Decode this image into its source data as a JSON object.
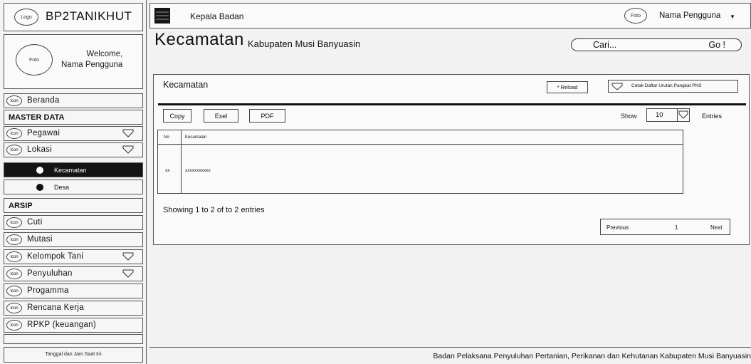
{
  "sidebar": {
    "logo_label": "Logo",
    "brand": "BP2TANIKHUT",
    "photo_label": "Foto",
    "welcome_line1": "Welcome,",
    "welcome_line2": "Nama Pengguna",
    "icon_label": "Icon",
    "home": "Beranda",
    "master_header": "MASTER DATA",
    "pegawai": "Pegawai",
    "lokasi": "Lokasi",
    "kecamatan": "Kecamatan",
    "desa": "Desa",
    "arsip_header": "ARSIP",
    "cuti": "Cuti",
    "mutasi": "Mutasi",
    "kelompok_tani": "Kelompok Tani",
    "penyuluhan": "Penyuluhan",
    "progamma": "Progamma",
    "rencana_kerja": "Rencana Kerja",
    "rpkp": "RPKP (keuangan)",
    "footer": "Tanggal dan Jam Saat Ini"
  },
  "header": {
    "role_title": "Kepala Badan",
    "photo_label": "Foto",
    "user_name": "Nama Pengguna",
    "caret": "▼"
  },
  "page": {
    "title": "Kecamatan",
    "subtitle": "Kabupaten Musi Banyuasin",
    "search_placeholder": "Cari...",
    "search_go": "Go !"
  },
  "panel": {
    "title": "Kecamatan",
    "reload": "* Reload",
    "cetak": "Cetak Daftar Urutan Pangkat PNS",
    "export_copy": "Copy",
    "export_excel": "Exel",
    "export_pdf": "PDF",
    "show_label": "Show",
    "show_value": "10",
    "entries_label": "Entries",
    "columns": [
      "No",
      "Kecamatan"
    ],
    "rows": [
      [
        "xx",
        "xxxxxxxxxxx"
      ]
    ],
    "info": "Showing 1 to 2 of to 2 entries",
    "pager_prev": "Previous",
    "pager_page": "1",
    "pager_next": "Next"
  },
  "footer": {
    "text": "Badan Pelaksana Penyuluhan Pertanian, Perikanan dan Kehutanan Kabupaten Musi Banyuasin"
  }
}
